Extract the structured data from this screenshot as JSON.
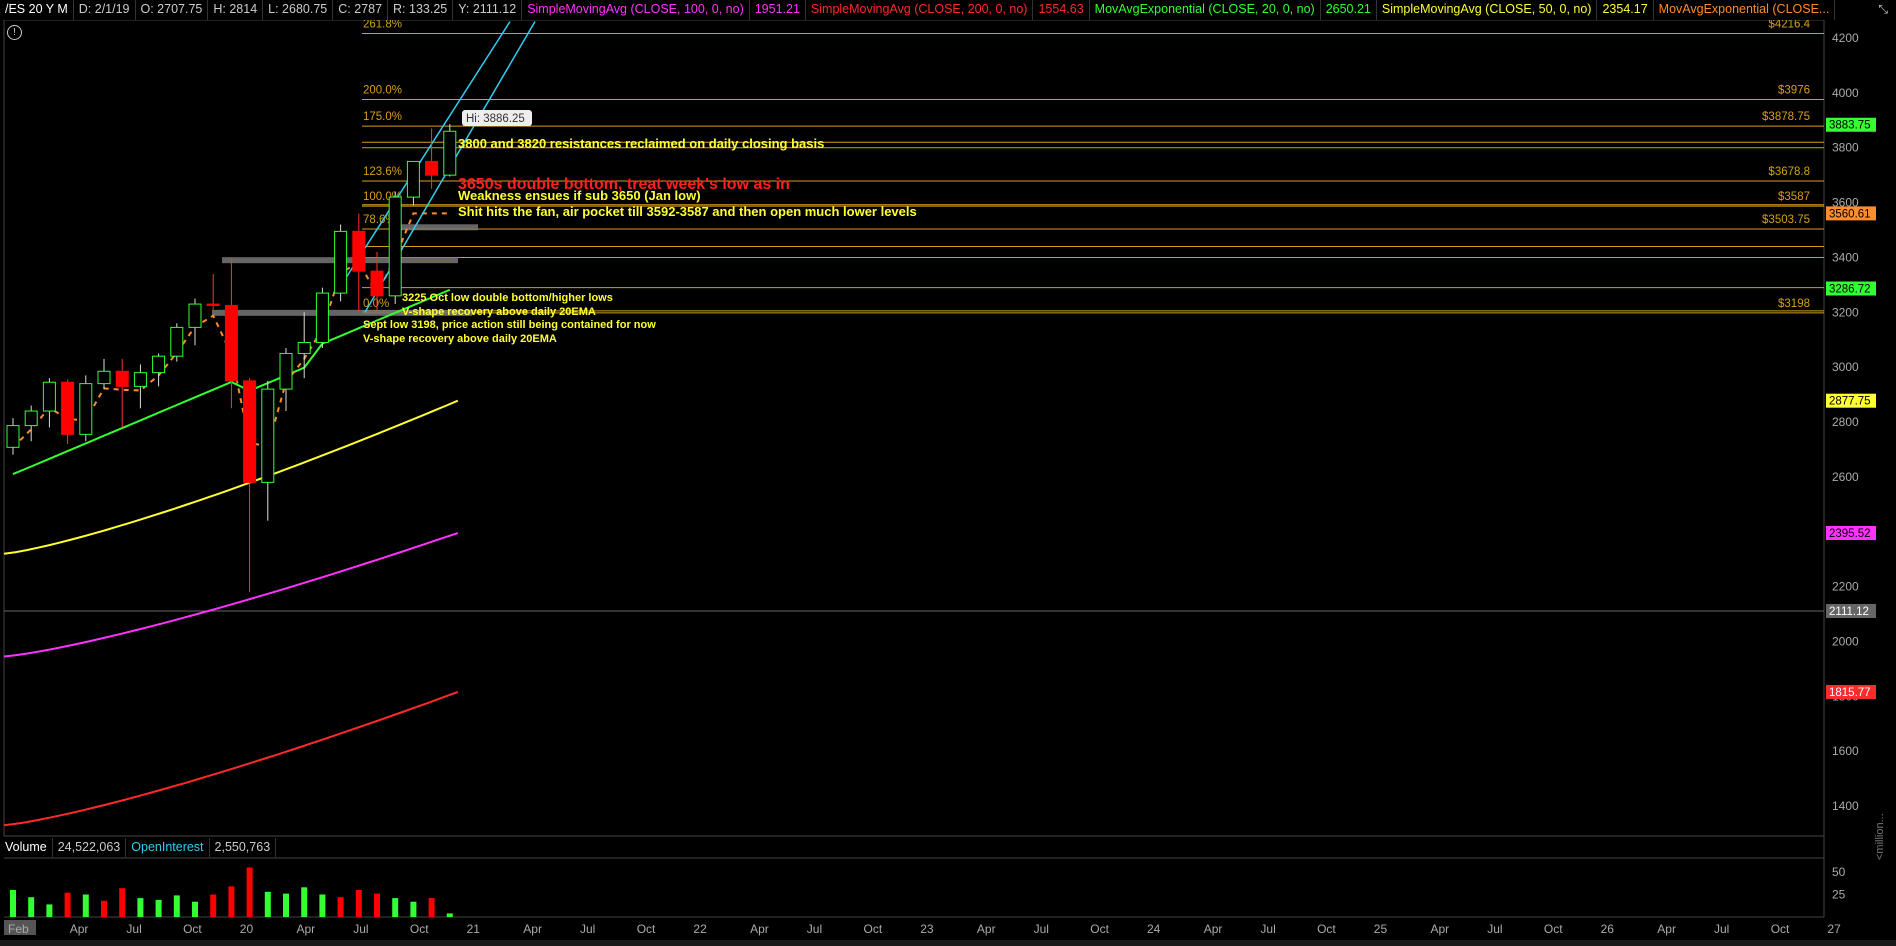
{
  "header": {
    "symbol": "/ES 20 Y M",
    "date": "D: 2/1/19",
    "open": "O: 2707.75",
    "high": "H: 2814",
    "low": "L: 2680.75",
    "close": "C: 2787",
    "range": "R: 133.25",
    "ycursor": "Y: 2111.12",
    "studies": [
      {
        "label": "SimpleMovingAvg (CLOSE, 100, 0, no)",
        "value": "1951.21",
        "color": "#ff33ff"
      },
      {
        "label": "SimpleMovingAvg (CLOSE, 200, 0, no)",
        "value": "1554.63",
        "color": "#ff2a2a"
      },
      {
        "label": "MovAvgExponential (CLOSE, 20, 0, no)",
        "value": "2650.21",
        "color": "#33ff33"
      },
      {
        "label": "SimpleMovingAvg (CLOSE, 50, 0, no)",
        "value": "2354.17",
        "color": "#ffff33"
      },
      {
        "label": "MovAvgExponential (CLOSE...",
        "value": "",
        "color": "#ff8c2a"
      }
    ]
  },
  "volume_bar": {
    "volume_label": "Volume",
    "volume_value": "24,522,063",
    "oi_label": "OpenInterest",
    "oi_value": "2,550,763"
  },
  "colors": {
    "up": "#33ff33",
    "down": "#ff0000",
    "fib": "#d4a017",
    "annotation": "#ffff33",
    "red_text": "#ff2020",
    "ema20": "#33ff33",
    "sma50": "#ffff33",
    "sma100": "#ff33ff",
    "sma200": "#ff2a2a",
    "ema_orange": "#ff8c2a",
    "channel": "#33ccee"
  },
  "chart_data": {
    "type": "candlestick",
    "y_range": [
      1300,
      4250
    ],
    "y_ticks": [
      1400,
      1600,
      1800,
      2000,
      2200,
      2400,
      2600,
      2800,
      3000,
      3200,
      3400,
      3600,
      3800,
      4000,
      4200
    ],
    "x_axis_labels": [
      "Feb",
      "Apr",
      "Jul",
      "Oct",
      "20",
      "Apr",
      "Jul",
      "Oct",
      "21",
      "Apr",
      "Jul",
      "Oct",
      "22",
      "Apr",
      "Jul",
      "Oct",
      "23",
      "Apr",
      "Jul",
      "Oct",
      "24",
      "Apr",
      "Jul",
      "Oct",
      "25",
      "Apr",
      "Jul",
      "Oct",
      "26",
      "Apr",
      "Jul",
      "Oct",
      "27"
    ],
    "price_badges": [
      {
        "value": "3883.75",
        "bg": "#33ff33",
        "fg": "#000"
      },
      {
        "value": "3560.61",
        "bg": "#ff8c2a",
        "fg": "#000"
      },
      {
        "value": "3286.72",
        "bg": "#33ff33",
        "fg": "#000"
      },
      {
        "value": "2877.75",
        "bg": "#ffff33",
        "fg": "#000"
      },
      {
        "value": "2395.52",
        "bg": "#ff33ff",
        "fg": "#000"
      },
      {
        "value": "2111.12",
        "bg": "#666666",
        "fg": "#fff"
      },
      {
        "value": "1815.77",
        "bg": "#ff2a2a",
        "fg": "#fff"
      }
    ],
    "candles": [
      {
        "o": 2707.75,
        "h": 2814,
        "l": 2680.75,
        "c": 2787
      },
      {
        "o": 2787,
        "h": 2860,
        "l": 2730,
        "c": 2840
      },
      {
        "o": 2840,
        "h": 2960,
        "l": 2780,
        "c": 2945
      },
      {
        "o": 2945,
        "h": 2955,
        "l": 2720,
        "c": 2755
      },
      {
        "o": 2755,
        "h": 2970,
        "l": 2730,
        "c": 2940
      },
      {
        "o": 2940,
        "h": 3030,
        "l": 2920,
        "c": 2985
      },
      {
        "o": 2985,
        "h": 3030,
        "l": 2780,
        "c": 2930
      },
      {
        "o": 2930,
        "h": 3010,
        "l": 2850,
        "c": 2980
      },
      {
        "o": 2980,
        "h": 3050,
        "l": 2930,
        "c": 3040
      },
      {
        "o": 3040,
        "h": 3160,
        "l": 3020,
        "c": 3145
      },
      {
        "o": 3145,
        "h": 3250,
        "l": 3080,
        "c": 3230
      },
      {
        "o": 3230,
        "h": 3340,
        "l": 3210,
        "c": 3225
      },
      {
        "o": 3225,
        "h": 3395,
        "l": 2850,
        "c": 2950
      },
      {
        "o": 2950,
        "h": 2960,
        "l": 2180,
        "c": 2580
      },
      {
        "o": 2580,
        "h": 2950,
        "l": 2440,
        "c": 2920
      },
      {
        "o": 2920,
        "h": 3070,
        "l": 2840,
        "c": 3050
      },
      {
        "o": 3050,
        "h": 3200,
        "l": 2960,
        "c": 3090
      },
      {
        "o": 3090,
        "h": 3290,
        "l": 3070,
        "c": 3270
      },
      {
        "o": 3270,
        "h": 3520,
        "l": 3240,
        "c": 3495
      },
      {
        "o": 3495,
        "h": 3560,
        "l": 3200,
        "c": 3350
      },
      {
        "o": 3350,
        "h": 3420,
        "l": 3200,
        "c": 3260
      },
      {
        "o": 3260,
        "h": 3640,
        "l": 3230,
        "c": 3620
      },
      {
        "o": 3620,
        "h": 3720,
        "l": 3590,
        "c": 3750
      },
      {
        "o": 3750,
        "h": 3870,
        "l": 3650,
        "c": 3700
      },
      {
        "o": 3700,
        "h": 3886.25,
        "l": 3695,
        "c": 3860
      }
    ],
    "volume": {
      "y_ticks": [
        25,
        50
      ],
      "bars": [
        {
          "v": 30,
          "dir": "up"
        },
        {
          "v": 22,
          "dir": "up"
        },
        {
          "v": 14,
          "dir": "up"
        },
        {
          "v": 27,
          "dir": "down"
        },
        {
          "v": 25,
          "dir": "up"
        },
        {
          "v": 18,
          "dir": "down"
        },
        {
          "v": 32,
          "dir": "down"
        },
        {
          "v": 21,
          "dir": "up"
        },
        {
          "v": 19,
          "dir": "up"
        },
        {
          "v": 24,
          "dir": "up"
        },
        {
          "v": 17,
          "dir": "up"
        },
        {
          "v": 25,
          "dir": "down"
        },
        {
          "v": 34,
          "dir": "down"
        },
        {
          "v": 55,
          "dir": "down"
        },
        {
          "v": 28,
          "dir": "up"
        },
        {
          "v": 26,
          "dir": "up"
        },
        {
          "v": 33,
          "dir": "up"
        },
        {
          "v": 25,
          "dir": "up"
        },
        {
          "v": 22,
          "dir": "down"
        },
        {
          "v": 30,
          "dir": "down"
        },
        {
          "v": 26,
          "dir": "down"
        },
        {
          "v": 21,
          "dir": "up"
        },
        {
          "v": 17,
          "dir": "up"
        },
        {
          "v": 21,
          "dir": "down"
        },
        {
          "v": 4,
          "dir": "up"
        }
      ]
    },
    "fib_levels": [
      {
        "pct": "261.8%",
        "price": 4216.4,
        "label": "$4216.4"
      },
      {
        "pct": "200.0%",
        "price": 3976,
        "label": "$3976"
      },
      {
        "pct": "175.0%",
        "price": 3878.75,
        "label": "$3878.75"
      },
      {
        "pct": "123.6%",
        "price": 3678.8,
        "label": "$3678.8"
      },
      {
        "pct": "100.0%",
        "price": 3587,
        "label": "$3587"
      },
      {
        "pct": "78.6%",
        "price": 3503.75,
        "label": "$3503.75"
      },
      {
        "pct": "0.0%",
        "price": 3198,
        "label": "$3198"
      }
    ],
    "extra_lines": [
      3820,
      3800,
      3592,
      3440,
      3400,
      3290,
      3205
    ],
    "annotations": [
      {
        "text": "Hi: 3886.25",
        "kind": "box"
      },
      {
        "text": "3800 and 3820 resistances reclaimed on daily closing basis",
        "kind": "yellow"
      },
      {
        "text": "3650s double bottom, treat week's low as in",
        "kind": "red"
      },
      {
        "text": "Weakness ensues if sub 3650 (Jan low)",
        "kind": "yellow"
      },
      {
        "text": "Shit hits the fan, air pocket till 3592-3587 and then open much lower levels",
        "kind": "yellow"
      },
      {
        "text": "3225 Oct low double bottom/higher lows",
        "kind": "small"
      },
      {
        "text": "V-shape recovery above daily 20EMA",
        "kind": "small"
      },
      {
        "text": "Sept low 3198, price action still being contained for now",
        "kind": "small"
      },
      {
        "text": "V-shape recovery above daily 20EMA",
        "kind": "small"
      }
    ],
    "y_unit_label": "<million..."
  }
}
